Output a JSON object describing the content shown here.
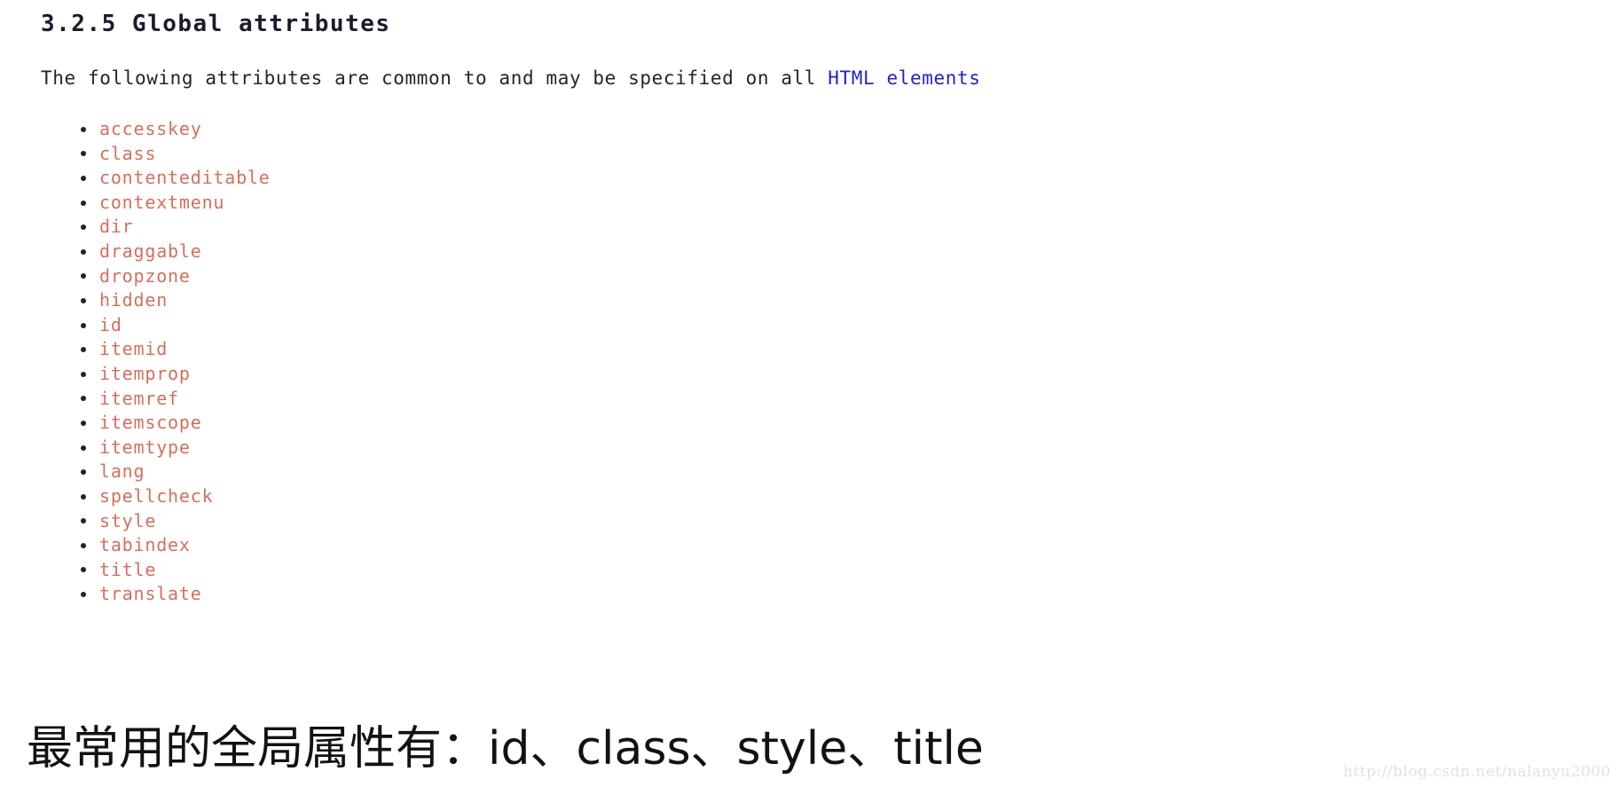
{
  "document": {
    "heading": "3.2.5 Global attributes",
    "intro": {
      "before_link": "The following attributes are common to and may be specified on all ",
      "link_text": "HTML elements",
      "after_link": ""
    },
    "attributes": [
      {
        "name": "accesskey"
      },
      {
        "name": "class"
      },
      {
        "name": "contenteditable"
      },
      {
        "name": "contextmenu"
      },
      {
        "name": "dir"
      },
      {
        "name": "draggable"
      },
      {
        "name": "dropzone"
      },
      {
        "name": "hidden"
      },
      {
        "name": "id"
      },
      {
        "name": "itemid"
      },
      {
        "name": "itemprop"
      },
      {
        "name": "itemref"
      },
      {
        "name": "itemscope"
      },
      {
        "name": "itemtype"
      },
      {
        "name": "lang"
      },
      {
        "name": "spellcheck"
      },
      {
        "name": "style"
      },
      {
        "name": "tabindex"
      },
      {
        "name": "title"
      },
      {
        "name": "translate"
      }
    ],
    "summary": "最常用的全局属性有：id、class、style、title",
    "watermark": "http://blog.csdn.net/nalanyu2000",
    "colors": {
      "heading": "#1b1b2b",
      "body_text": "#24242c",
      "link": "#2323c8",
      "attribute": "#d4705c",
      "bullet": "#222228",
      "summary": "#111116",
      "watermark": "#e2e2e2",
      "background": "#ffffff"
    }
  }
}
